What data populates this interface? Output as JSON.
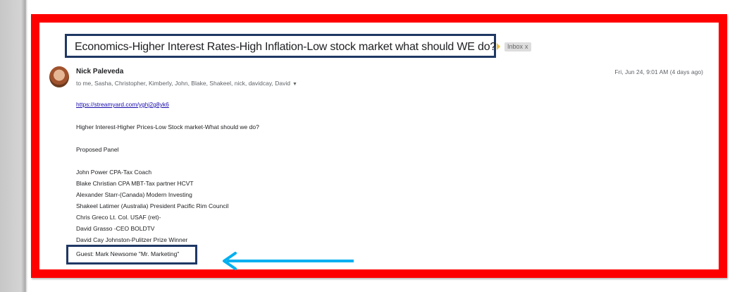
{
  "email": {
    "subject": "Economics-Higher Interest Rates-High Inflation-Low stock market what should WE do?",
    "label": "Inbox",
    "label_close": "x",
    "sender": "Nick Paleveda",
    "recipients": "to me, Sasha, Christopher, Kimberly, John, Blake, Shakeel, nick, davidcay, David",
    "date": "Fri, Jun 24, 9:01 AM (4 days ago)",
    "link": "https://streamyard.com/yghj2g8yk6",
    "heading_line": "Higher Interest-Higher Prices-Low Stock market-What should we do?",
    "panel_title": "Proposed Panel",
    "panel": [
      "John Power CPA-Tax Coach",
      "Blake Christian CPA MBT-Tax partner HCVT",
      "Alexander Starr-(Canada) Modern Investing",
      "Shakeel Latimer (Australia) President Pacific Rim Council",
      "Chris Greco Lt. Col. USAF (ret)-",
      "David Grasso -CEO BOLDTV",
      "David Cay Johnston-Pulitzer Prize Winner"
    ],
    "guest": "Guest: Mark Newsome \"Mr. Marketing\""
  },
  "colors": {
    "frame": "#ff0000",
    "highlight_box": "#1f3864",
    "arrow": "#00b0f0",
    "link": "#1a0dab"
  }
}
